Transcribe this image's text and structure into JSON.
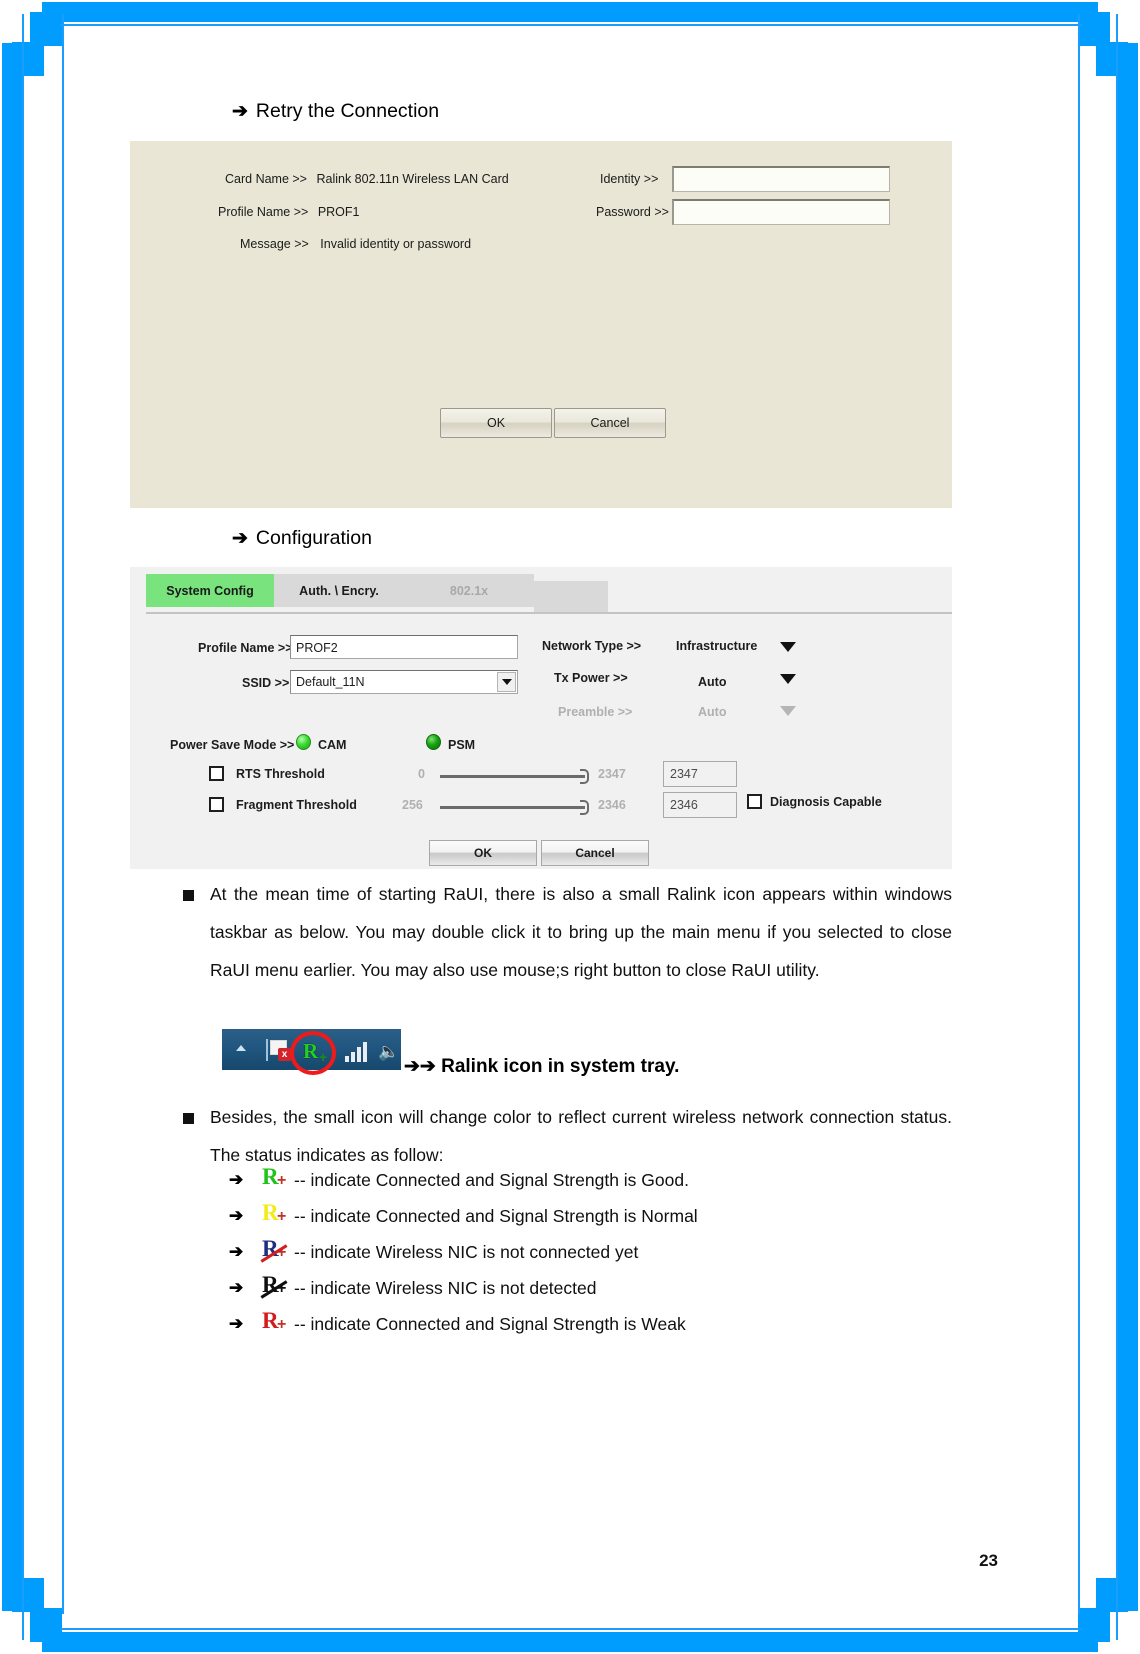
{
  "page": {
    "number": "23",
    "accent_color": "#009dff"
  },
  "headings": {
    "retry": {
      "arrow": "➔",
      "text": "Retry the Connection"
    },
    "configuration": {
      "arrow": "➔",
      "text": "Configuration"
    }
  },
  "retry_dialog": {
    "card_name_label": "Card Name >>",
    "card_name_value": "Ralink 802.11n Wireless LAN Card",
    "profile_name_label": "Profile Name >>",
    "profile_name_value": "PROF1",
    "message_label": "Message >>",
    "message_value": "Invalid identity or password",
    "identity_label": "Identity >>",
    "identity_value": "",
    "password_label": "Password >>",
    "password_value": "",
    "ok_label": "OK",
    "cancel_label": "Cancel",
    "background_color": "#e9e6d5"
  },
  "config_dialog": {
    "tabs": [
      {
        "label": "System Config",
        "state": "active",
        "color": "#79e37e"
      },
      {
        "label": "Auth. \\ Encry.",
        "state": "inactive"
      },
      {
        "label": "802.1x",
        "state": "disabled"
      }
    ],
    "profile_name_label": "Profile Name >>",
    "profile_name_value": "PROF2",
    "ssid_label": "SSID >>",
    "ssid_value": "Default_11N",
    "network_type_label": "Network Type >>",
    "network_type_value": "Infrastructure",
    "tx_power_label": "Tx Power >>",
    "tx_power_value": "Auto",
    "preamble_label": "Preamble >>",
    "preamble_value": "Auto",
    "power_save_label": "Power Save Mode >>",
    "power_save_options": [
      "CAM",
      "PSM"
    ],
    "rts_label": "RTS Threshold",
    "rts_min": "0",
    "rts_max": "2347",
    "rts_value": "2347",
    "frag_label": "Fragment Threshold",
    "frag_min": "256",
    "frag_max": "2346",
    "frag_value": "2346",
    "diagnosis_label": "Diagnosis Capable",
    "ok_label": "OK",
    "cancel_label": "Cancel"
  },
  "body": {
    "para1": "At the mean time of starting RaUI, there is also a small Ralink icon appears within windows taskbar as below. You may double click it to bring up the main menu if you selected to close RaUI menu earlier. You may also use mouse;s right button to close RaUI utility.",
    "tray_caption": "➔➔ Ralink icon in system tray.",
    "para2": "Besides, the small icon will change color to reflect current wireless network connection status. The status indicates as follow:"
  },
  "status_list": [
    {
      "arrow": "➔",
      "icon": "ralink-icon-green",
      "letter": "R",
      "plus": "+",
      "letter_color": "#22c21c",
      "plus_color": "#c1342a",
      "slashed": false,
      "text": "-- indicate Connected and Signal Strength is Good."
    },
    {
      "arrow": "➔",
      "icon": "ralink-icon-yellow",
      "letter": "R",
      "plus": "+",
      "letter_color": "#f3eb18",
      "plus_color": "#c1342a",
      "slashed": false,
      "text": "-- indicate Connected and Signal Strength is Normal"
    },
    {
      "arrow": "➔",
      "icon": "ralink-icon-blue-crossed",
      "letter": "R",
      "plus": "+",
      "letter_color": "#1d2f83",
      "plus_color": "#c1342a",
      "slashed": true,
      "slash_color": "#d11f1f",
      "text": "-- indicate Wireless NIC is not connected yet"
    },
    {
      "arrow": "➔",
      "icon": "ralink-icon-black-crossed",
      "letter": "R",
      "plus": "+",
      "letter_color": "#0f0f0f",
      "plus_color": "#0f0f0f",
      "slashed": true,
      "slash_color": "#0f0f0f",
      "text": "-- indicate Wireless NIC is not detected"
    },
    {
      "arrow": "➔",
      "icon": "ralink-icon-red",
      "letter": "R",
      "plus": "+",
      "letter_color": "#d21c1c",
      "plus_color": "#c1342a",
      "slashed": false,
      "text": "-- indicate Connected and Signal Strength is Weak"
    }
  ],
  "tray": {
    "overflow_icon": "chevron-up-icon",
    "flag_icon": "flag-error-icon",
    "flag_badge": "x",
    "ralink_letter": "R",
    "ralink_plus": "+",
    "signal_icon": "signal-bars-icon",
    "volume_icon": "speaker-icon"
  }
}
